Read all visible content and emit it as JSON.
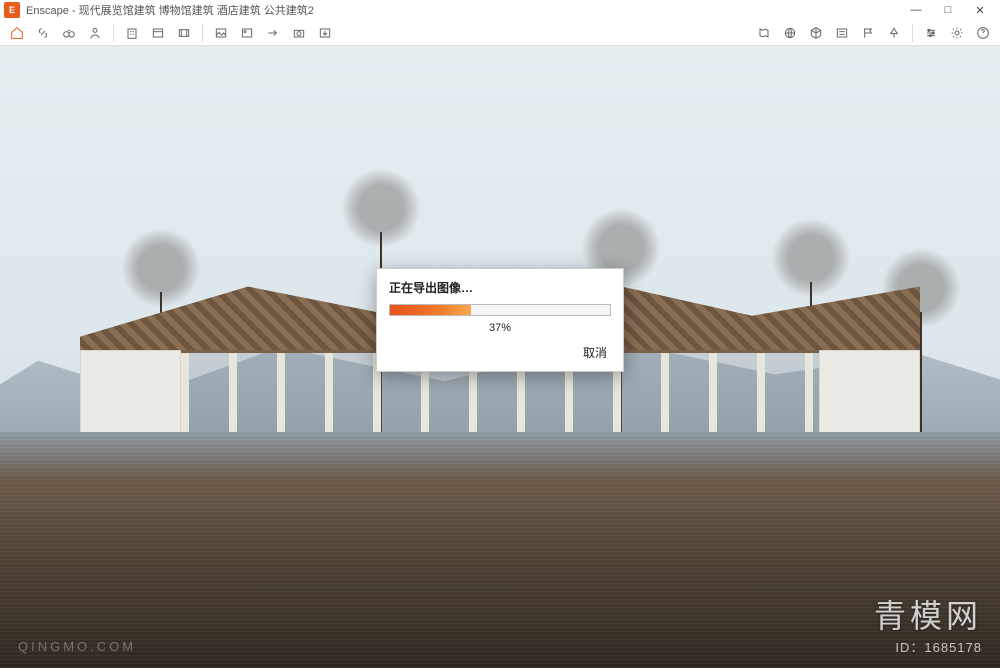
{
  "window": {
    "app_name": "Enscape",
    "title": "Enscape - 现代展览馆建筑 博物馆建筑 酒店建筑 公共建筑2",
    "controls": {
      "minimize": "—",
      "maximize": "□",
      "close": "✕"
    }
  },
  "toolbar": {
    "left_icons": [
      "home-icon",
      "link-icon",
      "binoculars-icon",
      "person-icon",
      "building-icon",
      "panel-icon",
      "film-icon",
      "image-icon",
      "picture-icon",
      "arrow-right-icon",
      "capture-icon",
      "export-icon"
    ],
    "right_icons": [
      "map-icon",
      "globe-icon",
      "cube-icon",
      "legend-icon",
      "flag-icon",
      "tree-icon",
      "slider-icon",
      "settings-icon",
      "help-icon"
    ]
  },
  "dialog": {
    "title": "正在导出图像…",
    "percent_value": 37,
    "percent_label": "37%",
    "cancel": "取消"
  },
  "watermark": {
    "center": "QINGMO.COM",
    "bottom_left": "QINGMO.COM",
    "brand": "青模网",
    "id_label": "ID：1685178"
  },
  "colors": {
    "accent": "#e85d1a"
  }
}
